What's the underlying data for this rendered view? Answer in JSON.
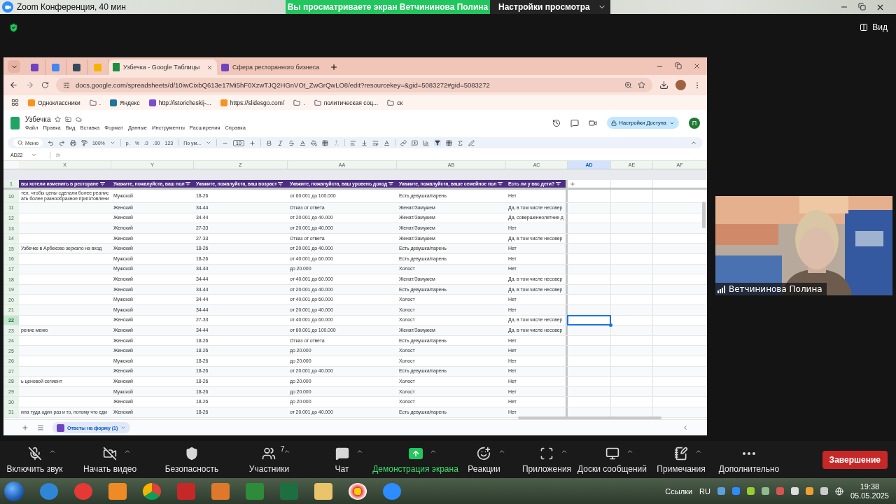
{
  "zoom": {
    "title": "Zoom Конференция, 40 мин",
    "banner": "Вы просматриваете экран Ветчининова Полина",
    "view_settings": "Настройки просмотра",
    "view_button": "Вид"
  },
  "browser": {
    "tabs": [
      {
        "label": "Узбечка - Google Таблицы",
        "selected": true
      },
      {
        "label": "Сфера ресторанного бизнеса",
        "selected": false
      }
    ],
    "url": "docs.google.com/spreadsheets/d/10iwCixbQ613e17Mi5hF0XzwTJQ2HGnVOt_ZwGrQwLO8/edit?resourcekey=&gid=5083272#gid=5083272",
    "bookmarks": [
      {
        "kind": "site",
        "label": "Одноклассники"
      },
      {
        "kind": "folder",
        "label": "."
      },
      {
        "kind": "site",
        "label": "Яндекс"
      },
      {
        "kind": "site",
        "label": "http://istoricheskij-..."
      },
      {
        "kind": "site",
        "label": "https://slidesgo.com/"
      },
      {
        "kind": "folder",
        "label": "."
      },
      {
        "kind": "folder",
        "label": "политическая соц..."
      },
      {
        "kind": "folder",
        "label": "ск"
      }
    ]
  },
  "sheet": {
    "title": "Узбечка",
    "menu": [
      "Файл",
      "Правка",
      "Вид",
      "Вставка",
      "Формат",
      "Данные",
      "Инструменты",
      "Расширения",
      "Справка"
    ],
    "share_button": "Настройки Доступа",
    "avatar": "П",
    "toolbar": {
      "search": "Меню",
      "zoom": "100%",
      "formats": [
        "р.",
        "%",
        ".0",
        ".00",
        "123"
      ],
      "font": "По ум...",
      "font_size": "10"
    },
    "name_box": "AD22",
    "formula_label": "fx",
    "columns": [
      {
        "letter": "X",
        "selected": false
      },
      {
        "letter": "Y",
        "selected": false
      },
      {
        "letter": "Z",
        "selected": false
      },
      {
        "letter": "AA",
        "selected": false
      },
      {
        "letter": "AB",
        "selected": false
      },
      {
        "letter": "AC",
        "selected": false
      },
      {
        "letter": "AD",
        "selected": true
      },
      {
        "letter": "AE",
        "selected": false
      },
      {
        "letter": "AF",
        "selected": false
      }
    ],
    "header_row": {
      "number": "1",
      "cells": [
        "вы хотели изменить в ресторане",
        "Укажите, пожалуйста, ваш пол",
        "Укажите, пожалуйста, ваш возраст",
        "Укажите, пожалуйста, ваш уровень доход",
        "Укажите, пожалуйста, ваше семейное пол",
        "Есть ли у вас дети?"
      ]
    },
    "rows": [
      {
        "number": "10",
        "selected": false,
        "x": "тел, чтобы цены сделали более реалис\nать более разнообразное приготовлени",
        "y": "Мужской",
        "z": "18-26",
        "aa": "от 60.001 до 100.000",
        "ab": "Есть девушка/парень",
        "ac": "Нет"
      },
      {
        "number": "11",
        "selected": false,
        "y": "Женский",
        "z": "34-44",
        "aa": "Отказ от ответа",
        "ab": "Женат/Замужем",
        "ac": "Да, в том числе несовер"
      },
      {
        "number": "12",
        "selected": false,
        "y": "Женский",
        "z": "34-44",
        "aa": "от 20.001 до 40.000",
        "ab": "Женат/Замужем",
        "ac": "Да, совершеннолетние д"
      },
      {
        "number": "13",
        "selected": false,
        "y": "Женский",
        "z": "27-33",
        "aa": "от 20.001 до 40.000",
        "ab": "Женат/Замужем",
        "ac": "Нет"
      },
      {
        "number": "14",
        "selected": false,
        "y": "Женский",
        "z": "27-33",
        "aa": "Отказ от ответа",
        "ab": "Женат/Замужем",
        "ac": "Да, в том числе несовер"
      },
      {
        "number": "15",
        "selected": false,
        "x": "Узбечке в Арбеково зеркало на вход",
        "y": "Женский",
        "z": "18-26",
        "aa": "от 20.001 до 40.000",
        "ab": "Есть девушка/парень",
        "ac": "Нет"
      },
      {
        "number": "16",
        "selected": false,
        "y": "Мужской",
        "z": "18-26",
        "aa": "от 40.001 до 60.000",
        "ab": "Есть девушка/парень",
        "ac": "Нет"
      },
      {
        "number": "17",
        "selected": false,
        "y": "Мужской",
        "z": "34-44",
        "aa": "до 20.000",
        "ab": "Холост",
        "ac": "Нет"
      },
      {
        "number": "18",
        "selected": false,
        "y": "Женский",
        "z": "34-44",
        "aa": "от 40.001 до 60.000",
        "ab": "Женат/Замужем",
        "ac": "Да, в том числе несовер"
      },
      {
        "number": "19",
        "selected": false,
        "y": "Женский",
        "z": "34-44",
        "aa": "от 20.001 до 40.000",
        "ab": "Есть девушка/парень",
        "ac": "Да, в том числе несовер"
      },
      {
        "number": "20",
        "selected": false,
        "y": "Мужской",
        "z": "34-44",
        "aa": "от 40.001 до 60.000",
        "ab": "Холост",
        "ac": "Нет"
      },
      {
        "number": "21",
        "selected": false,
        "y": "Мужской",
        "z": "34-44",
        "aa": "от 20.001 до 40.000",
        "ab": "Холост",
        "ac": "Нет"
      },
      {
        "number": "22",
        "selected": true,
        "y": "Женский",
        "z": "27-33",
        "aa": "от 40.001 до 60.000",
        "ab": "Холост",
        "ac": "Да, в том числе несовер"
      },
      {
        "number": "23",
        "selected": false,
        "x": "рение меню",
        "y": "Женский",
        "z": "34-44",
        "aa": "от 60.001 до 100.000",
        "ab": "Женат/Замужем",
        "ac": "Да, в том числе несовер"
      },
      {
        "number": "24",
        "selected": false,
        "y": "Женский",
        "z": "18-26",
        "aa": "Отказ от ответа",
        "ab": "Есть девушка/парень",
        "ac": "Нет"
      },
      {
        "number": "25",
        "selected": false,
        "y": "Женский",
        "z": "18-26",
        "aa": "до 20.000",
        "ab": "Холост",
        "ac": "Нет"
      },
      {
        "number": "26",
        "selected": false,
        "y": "Мужской",
        "z": "18-26",
        "aa": "до 20.000",
        "ab": "Холост",
        "ac": "Нет"
      },
      {
        "number": "27",
        "selected": false,
        "y": "Женский",
        "z": "18-26",
        "aa": "от 20.001 до 40.000",
        "ab": "Есть девушка/парень",
        "ac": "Нет"
      },
      {
        "number": "28",
        "selected": false,
        "x": "ь ценовой сегмент",
        "y": "Женский",
        "z": "18-26",
        "aa": "до 20.000",
        "ab": "Холост",
        "ac": "Нет"
      },
      {
        "number": "29",
        "selected": false,
        "y": "Мужской",
        "z": "18-26",
        "aa": "до 20.000",
        "ab": "Холост",
        "ac": "Нет"
      },
      {
        "number": "30",
        "selected": false,
        "y": "Женский",
        "z": "18-26",
        "aa": "до 20.000",
        "ab": "Холост",
        "ac": "Нет"
      },
      {
        "number": "31",
        "selected": false,
        "x": "ила туда один раз и то, потому что еди",
        "y": "Женский",
        "z": "18-26",
        "aa": "от 20.001 до 40.000",
        "ab": "Есть девушка/парень",
        "ac": "Нет"
      }
    ],
    "sheet_tab": "Ответы на форму (1)"
  },
  "video": {
    "name": "Ветчининова Полина"
  },
  "controls": [
    {
      "kind": "mic",
      "label": "Включить звук",
      "caret": true,
      "active": false
    },
    {
      "kind": "video",
      "label": "Начать видео",
      "caret": true,
      "active": false
    },
    {
      "kind": "security",
      "label": "Безопасность",
      "caret": false,
      "active": false
    },
    {
      "kind": "participants",
      "label": "Участники",
      "count": "7",
      "caret": true,
      "active": false
    },
    {
      "kind": "chat",
      "label": "Чат",
      "caret": true,
      "active": false
    },
    {
      "kind": "share",
      "label": "Демонстрация экрана",
      "caret": true,
      "active": true
    },
    {
      "kind": "reactions",
      "label": "Реакции",
      "caret": true,
      "active": false
    },
    {
      "kind": "apps",
      "label": "Приложения",
      "caret": true,
      "active": false
    },
    {
      "kind": "whiteboards",
      "label": "Доски сообщений",
      "caret": true,
      "active": false
    },
    {
      "kind": "notes",
      "label": "Примечания",
      "caret": true,
      "active": false
    },
    {
      "kind": "more",
      "label": "Дополнительно",
      "caret": false,
      "active": false
    }
  ],
  "end_button": "Завершение",
  "taskbar": {
    "links": "Ссылки",
    "language": "RU",
    "time": "19:38",
    "date": "05.05.2025"
  }
}
